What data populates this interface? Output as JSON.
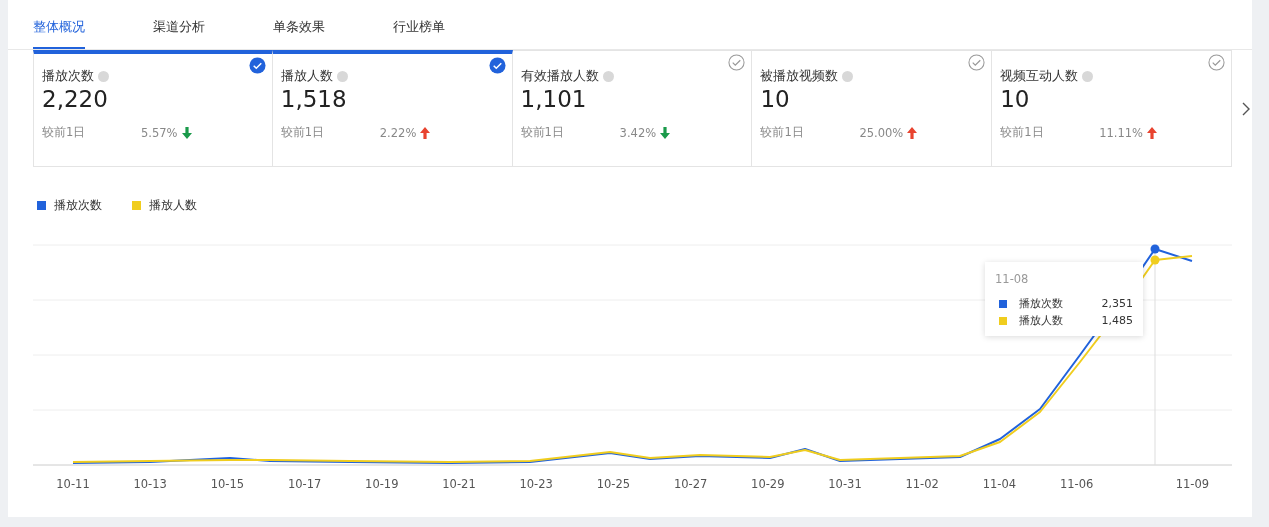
{
  "tabs": [
    {
      "label": "整体概况",
      "selected": true
    },
    {
      "label": "渠道分析",
      "selected": false
    },
    {
      "label": "单条效果",
      "selected": false
    },
    {
      "label": "行业榜单",
      "selected": false
    }
  ],
  "metrics": [
    {
      "label": "播放次数",
      "value": "2,220",
      "compare": "较前1日",
      "change": "5.57%",
      "rising": false,
      "checked": true
    },
    {
      "label": "播放人数",
      "value": "1,518",
      "compare": "较前1日",
      "change": "2.22%",
      "rising": true,
      "checked": true
    },
    {
      "label": "有效播放人数",
      "value": "1,101",
      "compare": "较前1日",
      "change": "3.42%",
      "rising": false,
      "checked": false
    },
    {
      "label": "被播放视频数",
      "value": "10",
      "compare": "较前1日",
      "change": "25.00%",
      "rising": true,
      "checked": false
    },
    {
      "label": "视频互动人数",
      "value": "10",
      "compare": "较前1日",
      "change": "11.11%",
      "rising": true,
      "checked": false
    }
  ],
  "legend": [
    {
      "label": "播放次数",
      "color": "#2162db"
    },
    {
      "label": "播放人数",
      "color": "#f0cd1e"
    }
  ],
  "x_labels": [
    "10-11",
    "10-13",
    "10-15",
    "10-17",
    "10-19",
    "10-21",
    "10-23",
    "10-25",
    "10-27",
    "10-29",
    "10-31",
    "11-02",
    "11-04",
    "11-06",
    "11-09"
  ],
  "tooltip": {
    "date": "11-08",
    "rows": [
      {
        "label": "播放次数",
        "value": "2,351",
        "color": "#2162db"
      },
      {
        "label": "播放人数",
        "value": "1,485",
        "color": "#f0cd1e"
      }
    ]
  }
}
